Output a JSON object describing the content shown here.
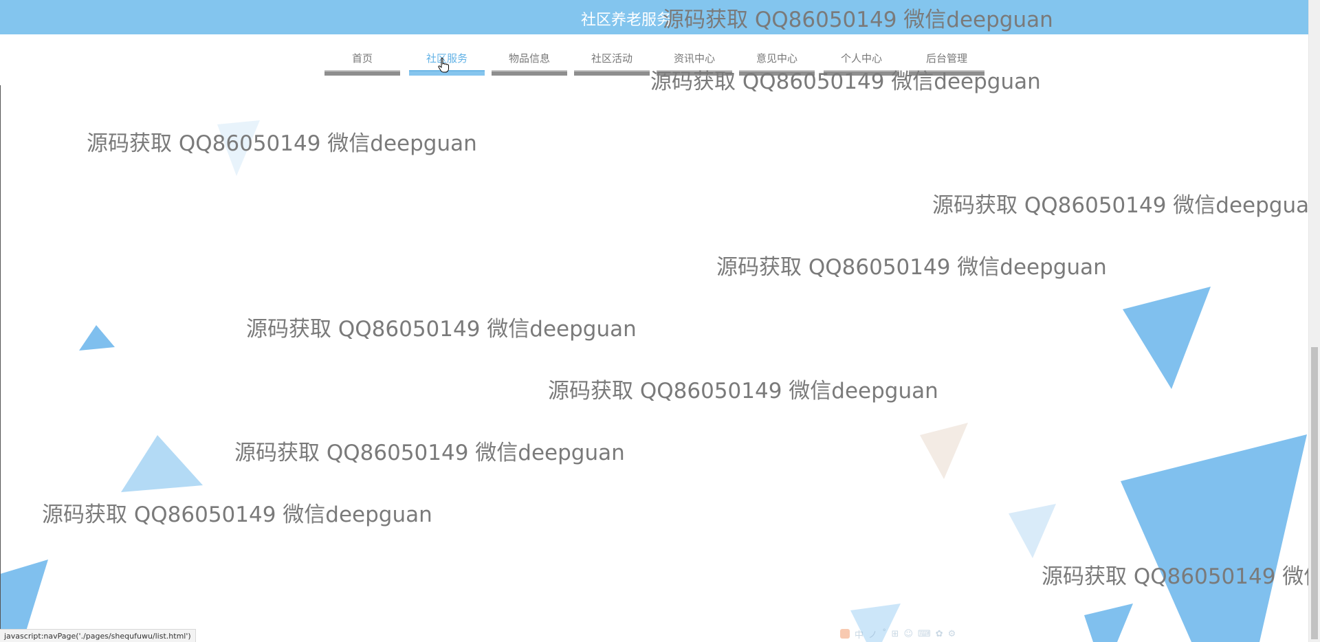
{
  "header": {
    "title": "社区养老服务"
  },
  "nav": {
    "items": [
      {
        "label": "首页",
        "active": false
      },
      {
        "label": "社区服务",
        "active": true
      },
      {
        "label": "物品信息",
        "active": false
      },
      {
        "label": "社区活动",
        "active": false
      },
      {
        "label": "资讯中心",
        "active": false
      },
      {
        "label": "意见中心",
        "active": false
      },
      {
        "label": "个人中心",
        "active": false
      },
      {
        "label": "后台管理",
        "active": false
      }
    ]
  },
  "watermark": {
    "text": "源码获取 QQ86050149 微信deepguan"
  },
  "status_bar": {
    "text": "javascript:navPage('./pages/shequfuwu/list.html')"
  },
  "ime_toolbar": {
    "items": [
      "中",
      "ノ",
      "˚",
      "⊞",
      "☺",
      "⌨",
      "✿",
      "⚙"
    ]
  },
  "colors": {
    "header_bg": "#83c5ee",
    "nav_active": "#62b2e6",
    "triangle_primary": "#80bfee",
    "triangle_light": "#bfe0f7",
    "triangle_beige": "#f3ebe4"
  }
}
